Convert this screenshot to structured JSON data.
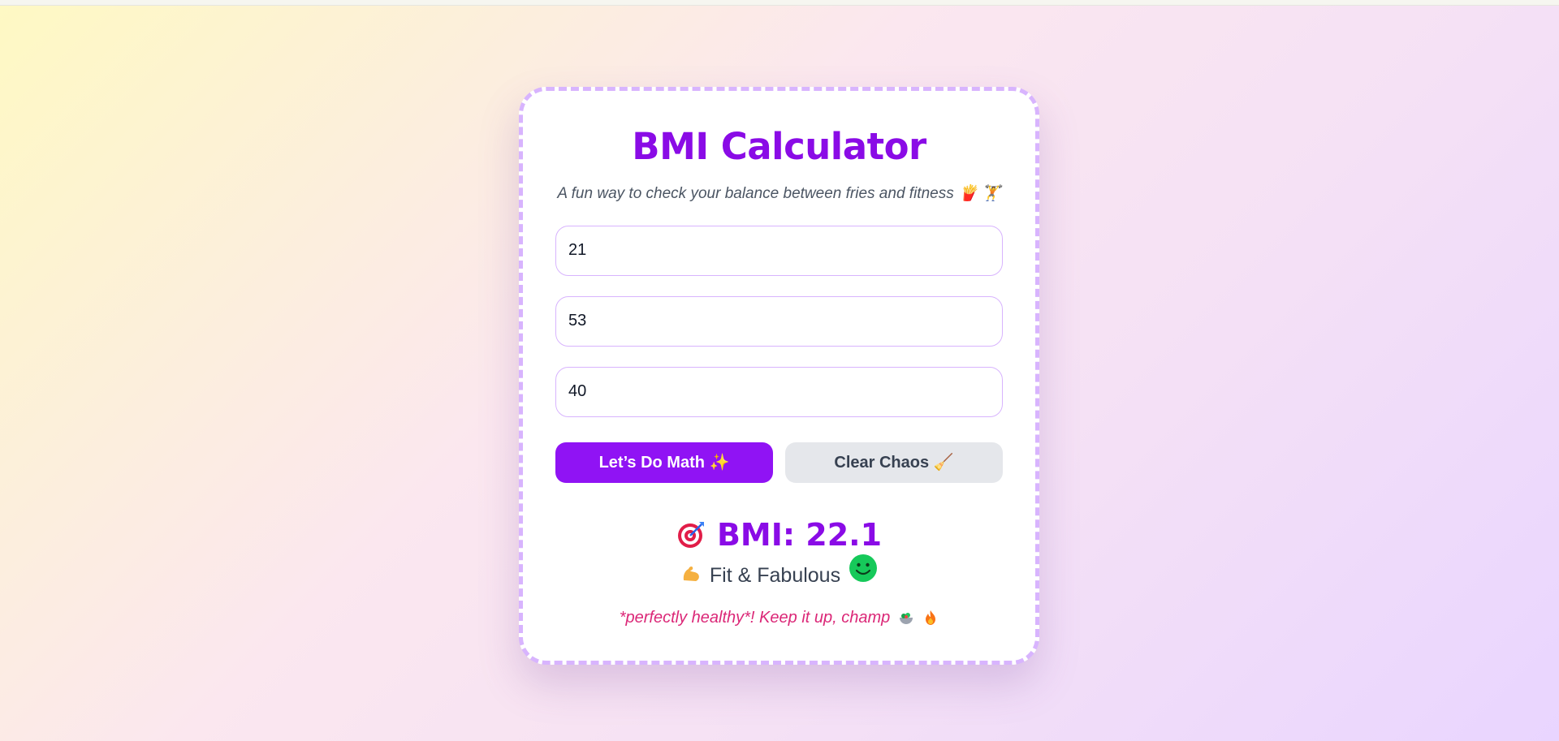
{
  "app": {
    "title": "BMI Calculator",
    "subtitle": "A fun way to check your balance between fries and fitness 🍟 🏋️"
  },
  "form": {
    "fields": [
      {
        "value": "21"
      },
      {
        "value": "53"
      },
      {
        "value": "40"
      }
    ]
  },
  "buttons": {
    "calculate_label": "Let’s Do Math ✨",
    "clear_label": "Clear Chaos 🧹"
  },
  "result": {
    "bmi_text": "BMI: 22.1",
    "category_text": "Fit & Fabulous",
    "message_text": "*perfectly healthy*! Keep it up, champ",
    "icons": [
      "target-icon",
      "flexed-biceps-icon",
      "smiley-icon",
      "salad-icon",
      "fire-icon"
    ]
  },
  "colors": {
    "accent": "#8a0be6",
    "primary_button": "#9013f4",
    "secondary_button": "#e5e7eb",
    "border": "#d8b4fe",
    "message": "#db2777",
    "smiley": "#16c95a"
  }
}
